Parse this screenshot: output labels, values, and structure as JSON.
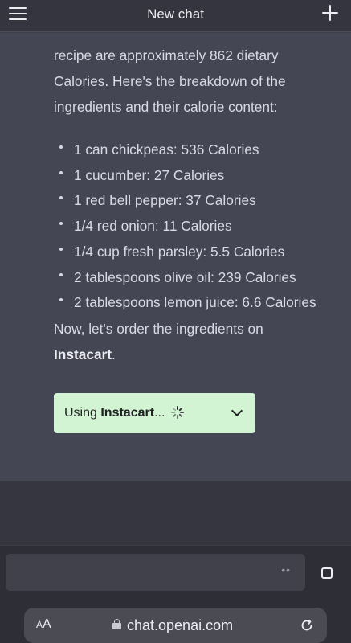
{
  "header": {
    "title": "New chat"
  },
  "message": {
    "intro_line1": "recipe are approximately 862 dietary",
    "intro_line2": "Calories. Here's the breakdown of the",
    "intro_line3": "ingredients and their calorie content:",
    "ingredients": [
      "1 can chickpeas: 536 Calories",
      "1 cucumber: 27 Calories",
      "1 red bell pepper: 37 Calories",
      "1/4 red onion: 11 Calories",
      "1/4 cup fresh parsley: 5.5 Calories",
      "2 tablespoons olive oil: 239 Calories",
      "2 tablespoons lemon juice: 6.6 Calories"
    ],
    "order_line1": "Now, let's order the ingredients on",
    "order_brand": "Instacart",
    "order_period": "."
  },
  "plugin": {
    "prefix": "Using ",
    "name": "Instacart",
    "suffix": "...",
    "background": "#d2f4d3"
  },
  "input": {
    "dots": "••"
  },
  "browser": {
    "aa_small": "A",
    "aa_large": "A",
    "domain": "chat.openai.com"
  },
  "colors": {
    "chat_bg": "#444654",
    "header_bg": "#34353e",
    "text": "#d9d9e3"
  }
}
